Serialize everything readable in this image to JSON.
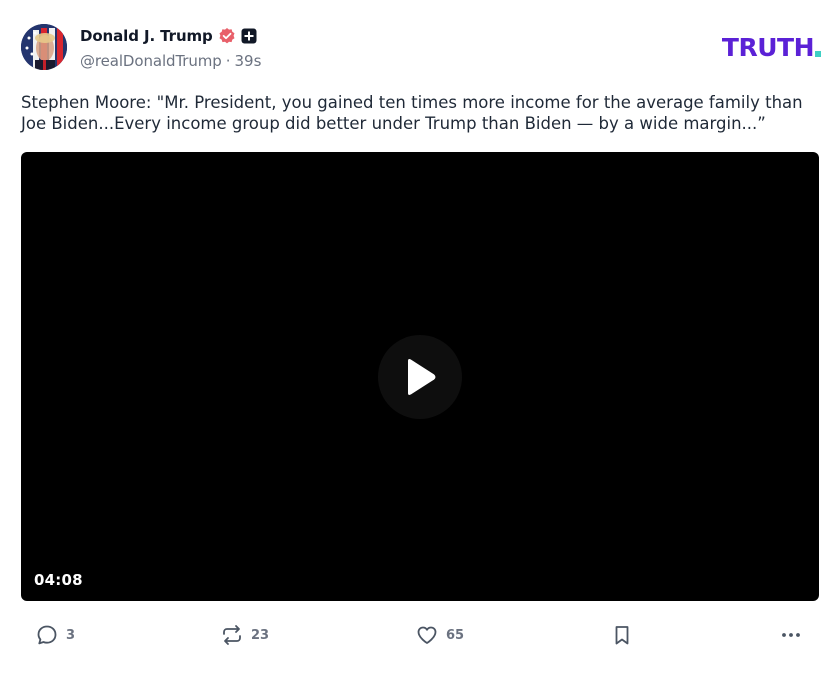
{
  "author": {
    "display_name": "Donald J. Trump",
    "handle": "@realDonaldTrump",
    "time_ago": "39s",
    "separator": "·",
    "verified_icon": "verified-badge-icon",
    "plus_icon": "plus-badge-icon"
  },
  "brand": {
    "name": "TRUTH",
    "primary_color": "#5b21d6",
    "dot_color": "#3ed0c4"
  },
  "status": {
    "text": "Stephen Moore: \"Mr. President, you gained ten times more income for the average family than Joe Biden...Every income group did better under Trump than Biden — by a wide margin...”"
  },
  "video": {
    "duration": "04:08",
    "play_icon": "play-icon"
  },
  "actions": {
    "replies": {
      "count": "3",
      "icon": "reply-icon"
    },
    "retruths": {
      "count": "23",
      "icon": "retruth-icon"
    },
    "likes": {
      "count": "65",
      "icon": "heart-icon"
    },
    "bookmark": {
      "icon": "bookmark-icon"
    },
    "more": {
      "icon": "more-horizontal-icon"
    }
  },
  "colors": {
    "text": "#1f2937",
    "muted": "#6b7280",
    "verified": "#e8606a",
    "video_bg": "#000000"
  }
}
